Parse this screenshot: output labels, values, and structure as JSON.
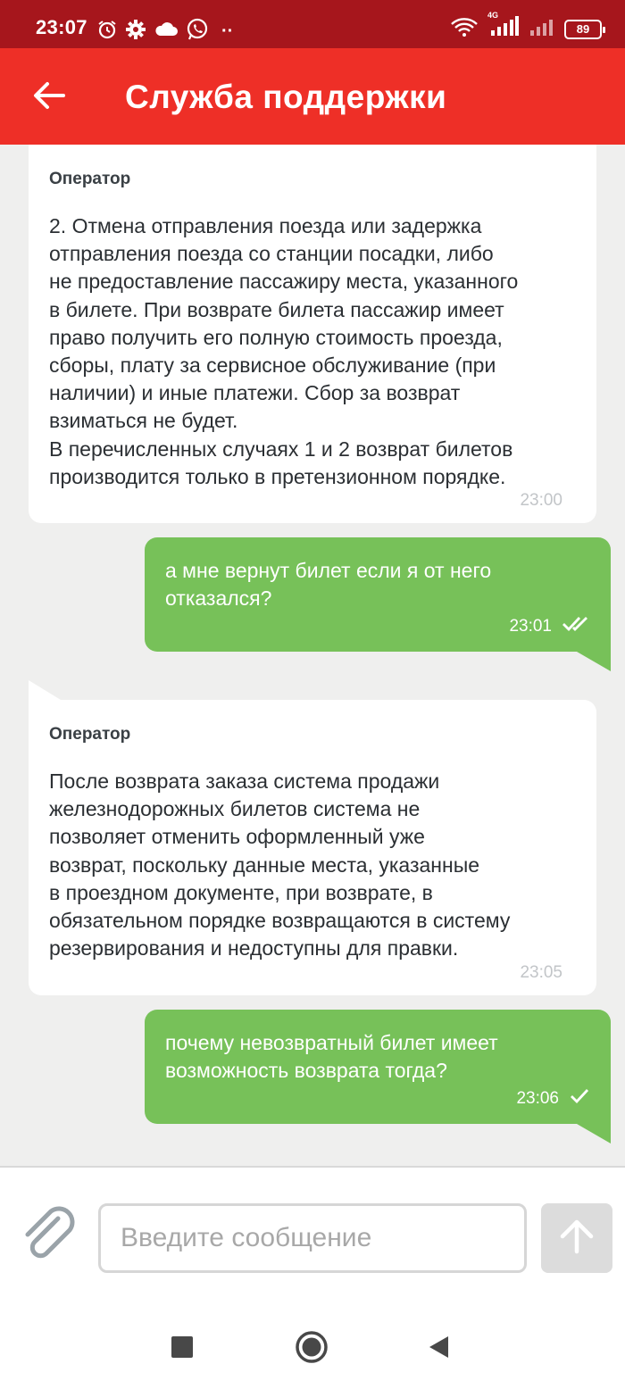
{
  "status_bar": {
    "time": "23:07",
    "battery": "89",
    "network": "4G",
    "left_icons": [
      "alarm-icon",
      "gear-icon",
      "cloud-icon",
      "whatsapp-icon",
      "more-dots-icon"
    ],
    "right_icons": [
      "wifi-icon",
      "signal-icon",
      "signal-icon",
      "battery-icon"
    ]
  },
  "app_bar": {
    "title": "Служба поддержки",
    "back_icon": "arrow-left-icon",
    "color": "#ee2f27"
  },
  "messages": [
    {
      "direction": "incoming",
      "sender": "Оператор",
      "text": "2. Отмена отправления поезда или задержка\nотправления поезда со станции посадки, либо\nне предоставление пассажиру места, указанного\nв билете. При возврате билета пассажир имеет\nправо получить его полную стоимость проезда,\nсборы, плату за сервисное обслуживание (при\nналичии) и иные платежи. Сбор за возврат\nвзиматься не будет.\nВ перечисленных случаях 1 и 2 возврат билетов\nпроизводится только в претензионном порядке.",
      "time": "23:00"
    },
    {
      "direction": "outgoing",
      "text": "а мне вернут билет если я от него\nотказался?",
      "time": "23:01",
      "status": "read"
    },
    {
      "direction": "incoming",
      "sender": "Оператор",
      "text": "После возврата заказа система продажи\nжелезнодорожных билетов система не\nпозволяет отменить оформленный уже\nвозврат, поскольку данные места, указанные\nв проездном документе, при возврате, в\nобязательном порядке возвращаются в систему\nрезервирования и недоступны для правки.",
      "time": "23:05"
    },
    {
      "direction": "outgoing",
      "text": "почему невозвратный билет имеет\nвозможность возврата тогда?",
      "time": "23:06",
      "status": "sent"
    }
  ],
  "composer": {
    "placeholder": "Введите сообщение",
    "value": "",
    "attach_icon": "paperclip-icon",
    "send_icon": "arrow-up-icon"
  },
  "nav_bar": {
    "buttons": [
      "recents-square-icon",
      "home-circle-icon",
      "back-triangle-icon"
    ]
  },
  "colors": {
    "status_bar": "#a6161c",
    "outgoing_bubble": "#77c159",
    "incoming_bubble": "#ffffff",
    "chat_background": "#efefee"
  }
}
